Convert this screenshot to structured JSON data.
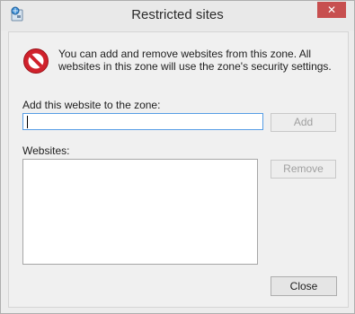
{
  "window": {
    "title": "Restricted sites",
    "close_glyph": "✕",
    "app_icon": "internet-options-icon"
  },
  "info": {
    "icon": "restricted-zone-icon",
    "text": "You can add and remove websites from this zone. All websites in this zone will use the zone's security settings."
  },
  "add_site": {
    "label": "Add this website to the zone:",
    "value": "",
    "button_label": "Add"
  },
  "websites": {
    "label": "Websites:",
    "items": [],
    "remove_label": "Remove"
  },
  "footer": {
    "close_label": "Close"
  },
  "colors": {
    "close_button": "#c74f4f",
    "warn_icon": "#d0212b",
    "input_border": "#569de5"
  }
}
